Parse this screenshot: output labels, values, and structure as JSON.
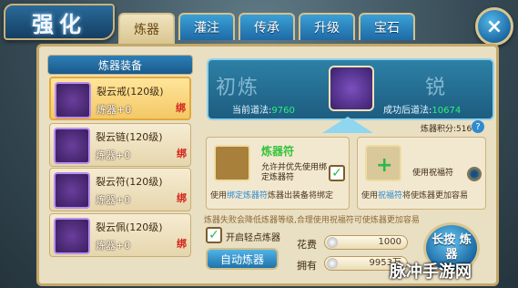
{
  "logo": "强化",
  "tabs": [
    {
      "label": "炼器",
      "active": true
    },
    {
      "label": "灌注",
      "active": false
    },
    {
      "label": "传承",
      "active": false
    },
    {
      "label": "升级",
      "active": false
    },
    {
      "label": "宝石",
      "active": false
    }
  ],
  "close_icon": "×",
  "list": {
    "header": "炼器装备",
    "items": [
      {
        "name": "裂云戒(120级)",
        "level": "炼器+0",
        "tag": "绑",
        "selected": true,
        "icon": "ring-icon"
      },
      {
        "name": "裂云链(120级)",
        "level": "炼器+0",
        "tag": "绑",
        "selected": false,
        "icon": "necklace-icon"
      },
      {
        "name": "裂云符(120级)",
        "level": "炼器+0",
        "tag": "绑",
        "selected": false,
        "icon": "talisman-icon"
      },
      {
        "name": "裂云佩(120级)",
        "level": "炼器+0",
        "tag": "绑",
        "selected": false,
        "icon": "pendant-icon"
      }
    ]
  },
  "preview": {
    "current_label": "当前道法:",
    "current_value": "9760",
    "after_label": "成功后道法:",
    "after_value": "10674",
    "glyph_left": "初炼",
    "glyph_right": "锐"
  },
  "score": {
    "label": "炼器积分:",
    "value": "516"
  },
  "card_left": {
    "title": "炼器符",
    "sub": "允许并优先使用绑定炼器符",
    "desc_prefix": "使用",
    "desc_highlight": "绑定炼器符",
    "desc_suffix": "炼器出装备将绑定",
    "checked": true
  },
  "card_right": {
    "sub": "使用祝福符",
    "desc_prefix": "使用",
    "desc_highlight": "祝福符",
    "desc_suffix": "将使炼器更加容易",
    "checked": false
  },
  "hint": "炼器失败会降低炼器等级,合理使用祝福符可使炼器更加容易",
  "light_option": {
    "label": "开启轻点炼器",
    "checked": true
  },
  "cost": {
    "label": "花费",
    "value": "1000"
  },
  "owned": {
    "label": "拥有",
    "value": "9953万"
  },
  "auto_button": "自动炼器",
  "press_button": "长按 炼器",
  "watermark": "脉冲手游网"
}
